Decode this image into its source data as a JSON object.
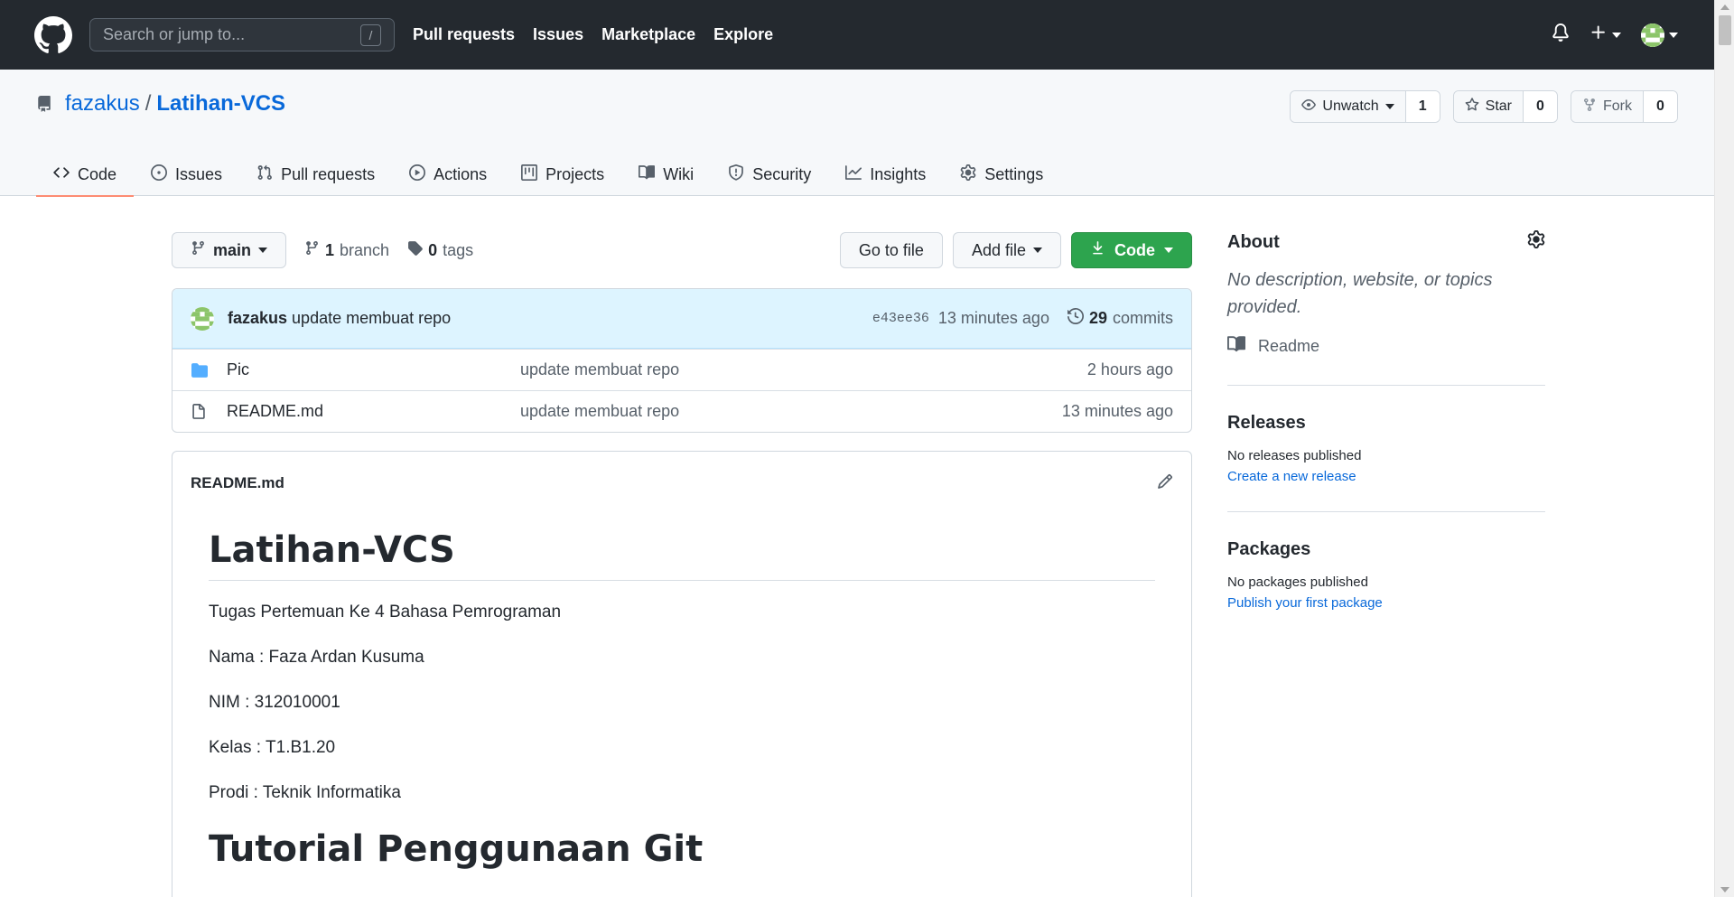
{
  "header": {
    "search_placeholder": "Search or jump to...",
    "search_shortcut": "/",
    "nav": [
      "Pull requests",
      "Issues",
      "Marketplace",
      "Explore"
    ]
  },
  "repo": {
    "owner": "fazakus",
    "separator": "/",
    "name": "Latihan-VCS",
    "watch_label": "Unwatch",
    "watch_count": "1",
    "star_label": "Star",
    "star_count": "0",
    "fork_label": "Fork",
    "fork_count": "0"
  },
  "tabs": [
    {
      "label": "Code",
      "icon": "code-icon"
    },
    {
      "label": "Issues",
      "icon": "issue-icon"
    },
    {
      "label": "Pull requests",
      "icon": "pull-request-icon"
    },
    {
      "label": "Actions",
      "icon": "play-icon"
    },
    {
      "label": "Projects",
      "icon": "project-icon"
    },
    {
      "label": "Wiki",
      "icon": "book-icon"
    },
    {
      "label": "Security",
      "icon": "shield-icon"
    },
    {
      "label": "Insights",
      "icon": "graph-icon"
    },
    {
      "label": "Settings",
      "icon": "gear-icon"
    }
  ],
  "branchbar": {
    "branch": "main",
    "branch_count": "1",
    "branch_label": "branch",
    "tag_count": "0",
    "tag_label": "tags",
    "go_to_file": "Go to file",
    "add_file": "Add file",
    "code": "Code"
  },
  "commit": {
    "author": "fazakus",
    "message": "update membuat repo",
    "sha": "e43ee36",
    "time": "13 minutes ago",
    "count": "29",
    "count_label": "commits"
  },
  "files": [
    {
      "name": "Pic",
      "type": "folder",
      "message": "update membuat repo",
      "age": "2 hours ago"
    },
    {
      "name": "README.md",
      "type": "file",
      "message": "update membuat repo",
      "age": "13 minutes ago"
    }
  ],
  "readme": {
    "filename": "README.md",
    "h1": "Latihan-VCS",
    "lines": [
      "Tugas Pertemuan Ke 4 Bahasa Pemrograman",
      "Nama : Faza Ardan Kusuma",
      "NIM : 312010001",
      "Kelas : T1.B1.20",
      "Prodi : Teknik Informatika"
    ],
    "h2": "Tutorial Penggunaan Git"
  },
  "sidebar": {
    "about_title": "About",
    "about_desc": "No description, website, or topics provided.",
    "readme_link": "Readme",
    "releases_title": "Releases",
    "releases_text": "No releases published",
    "releases_link": "Create a new release",
    "packages_title": "Packages",
    "packages_text": "No packages published",
    "packages_link": "Publish your first package"
  },
  "colors": {
    "header_bg": "#24292f",
    "link": "#0969da",
    "green": "#2da44e",
    "tab_underline": "#fd8c73",
    "commit_bg": "#ddf4ff",
    "folder": "#54aeff"
  }
}
